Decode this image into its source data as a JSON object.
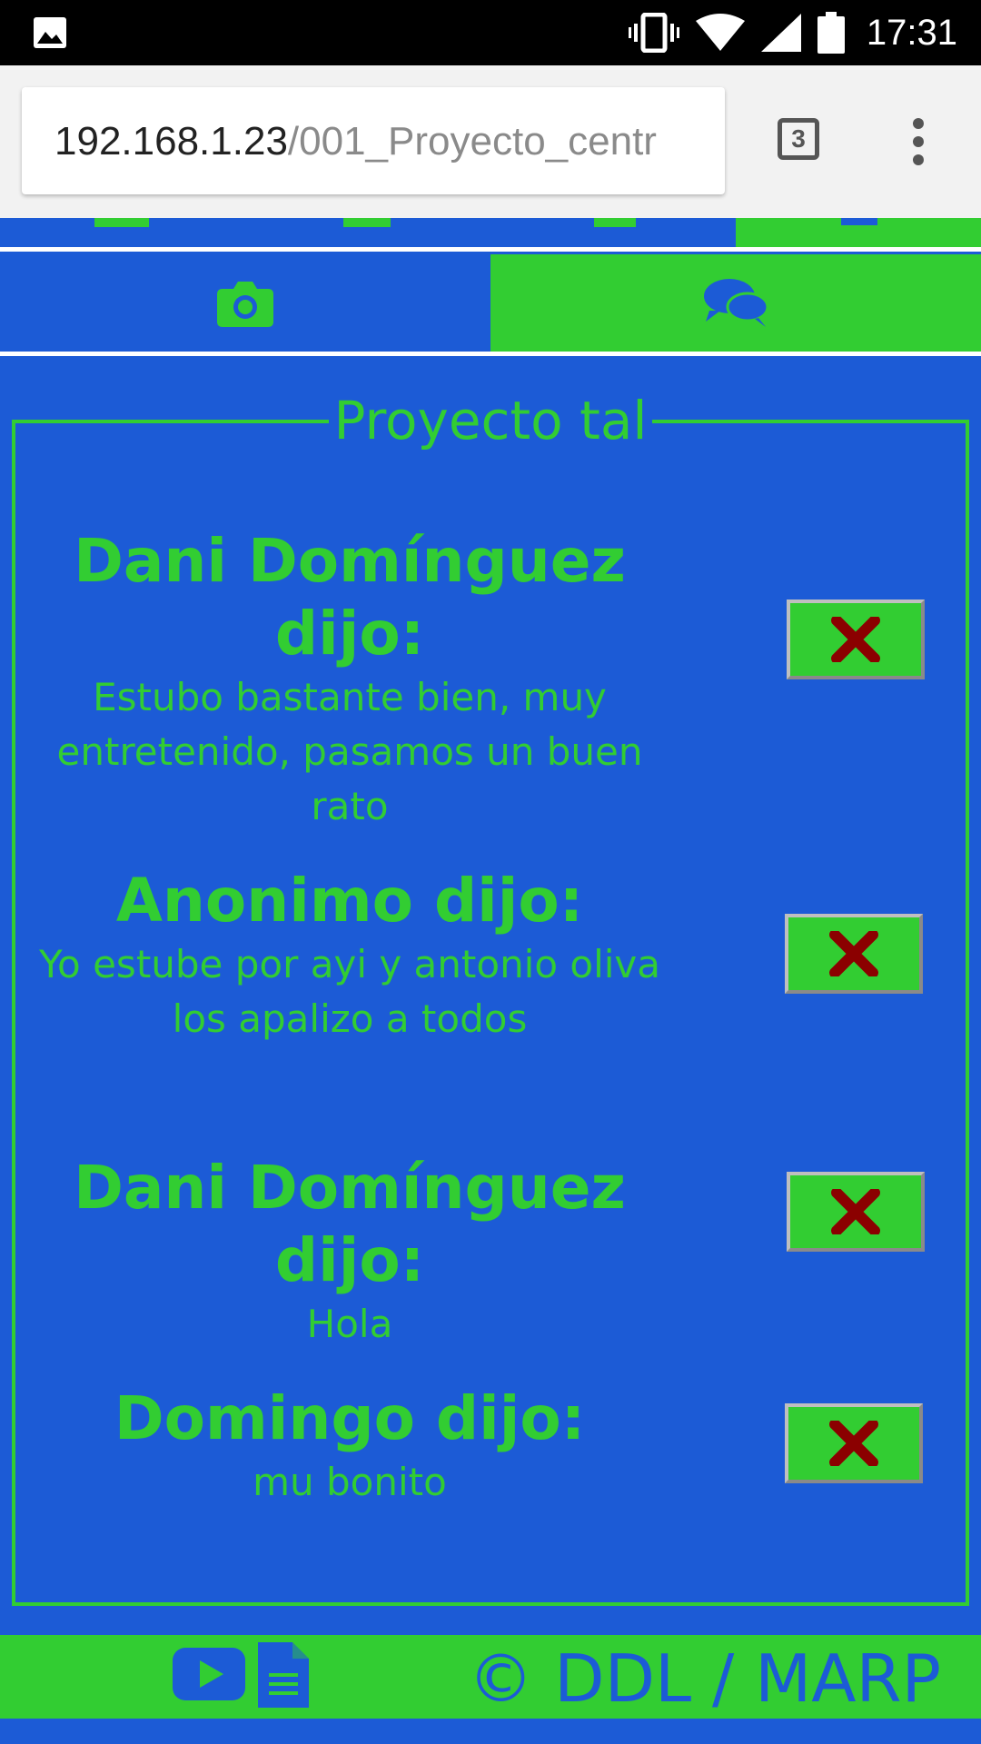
{
  "status_bar": {
    "time": "17:31"
  },
  "browser": {
    "url_host": "192.168.1.23",
    "url_path": "/001_Proyecto_centr",
    "tab_count": "3"
  },
  "tabs": [
    {
      "icon": "camera-icon",
      "active": false
    },
    {
      "icon": "comments-icon",
      "active": true
    }
  ],
  "panel": {
    "title": "Proyecto tal",
    "comments": [
      {
        "author": "Dani Domínguez dijo:",
        "text": "Estubo bastante bien, muy entretenido, pasamos un buen rato"
      },
      {
        "author": "Anonimo dijo:",
        "text": "Yo estube por ayi y antonio oliva los apalizo a todos"
      },
      {
        "author": "Dani Domínguez dijo:",
        "text": "Hola"
      },
      {
        "author": "Domingo dijo:",
        "text": "mu bonito"
      }
    ]
  },
  "footer": {
    "copyright": "© DDL / MARP"
  },
  "colors": {
    "blue": "#1c5bd6",
    "green": "#32cd32",
    "delete_x": "#8b0000"
  }
}
